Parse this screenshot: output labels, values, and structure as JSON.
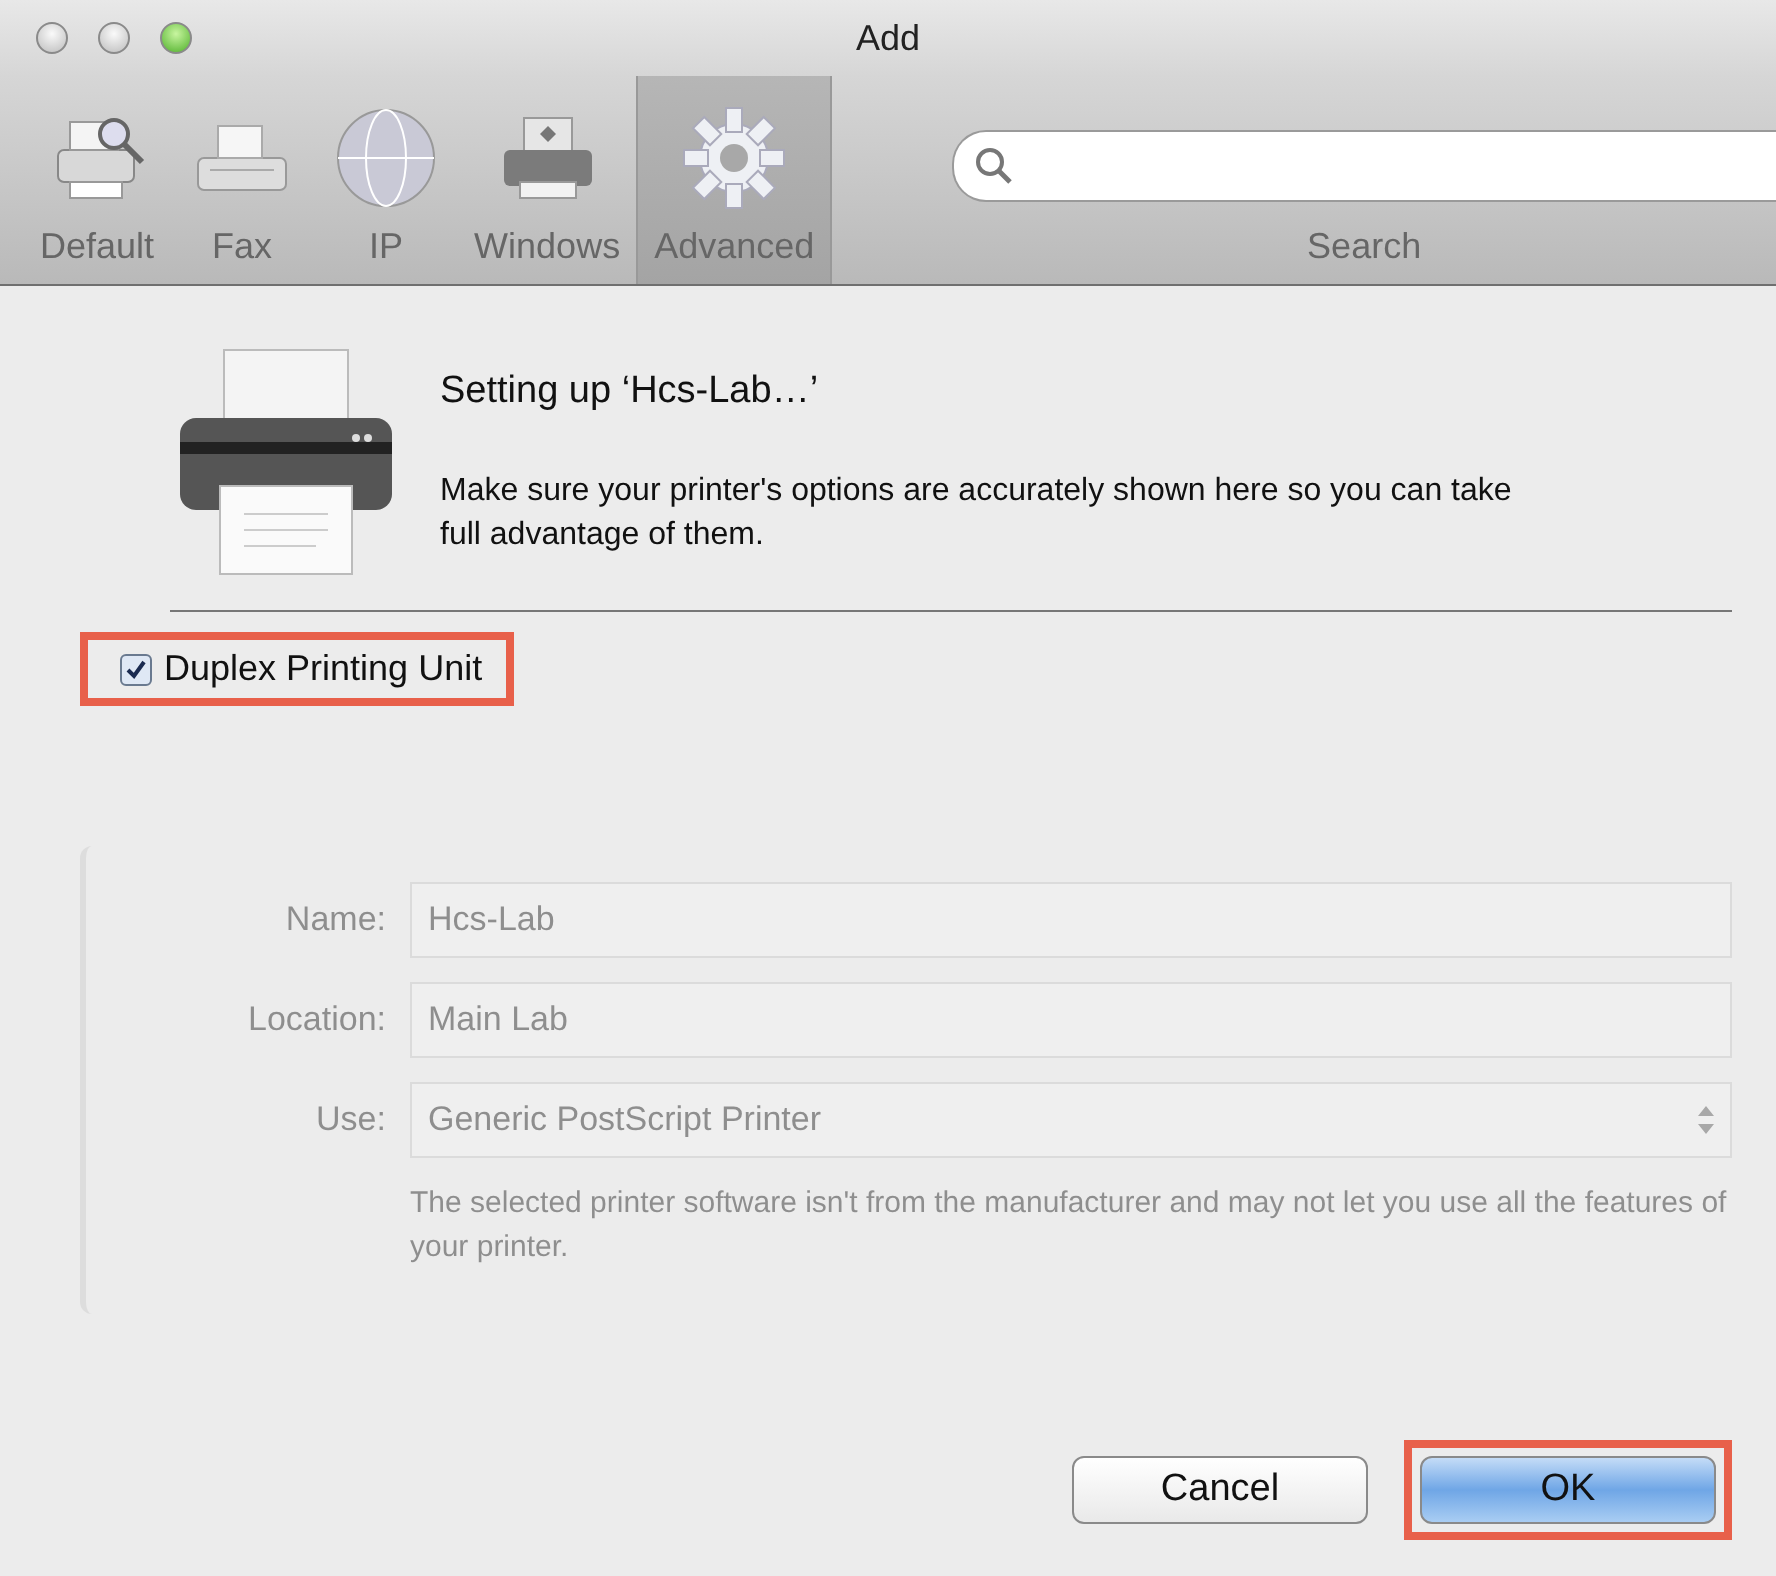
{
  "window": {
    "title": "Add"
  },
  "toolbar": {
    "items": [
      {
        "label": "Default",
        "kind": "default",
        "selected": false
      },
      {
        "label": "Fax",
        "kind": "fax",
        "selected": false
      },
      {
        "label": "IP",
        "kind": "ip",
        "selected": false
      },
      {
        "label": "Windows",
        "kind": "windows",
        "selected": false
      },
      {
        "label": "Advanced",
        "kind": "advanced",
        "selected": true
      }
    ],
    "search": {
      "label": "Search"
    }
  },
  "sheet": {
    "title": "Setting up ‘Hcs-Lab…’",
    "message": "Make sure your printer's options are accurately shown here so you can take full advantage of them.",
    "options": [
      {
        "label": "Duplex Printing Unit",
        "checked": true,
        "highlighted": true
      }
    ],
    "buttons": [
      {
        "label": "Cancel",
        "default": false,
        "highlighted": false
      },
      {
        "label": "OK",
        "default": true,
        "highlighted": true
      }
    ]
  },
  "background_form": {
    "disabled": true,
    "fields": [
      {
        "label": "Name:",
        "value": "Hcs-Lab",
        "kind": "text"
      },
      {
        "label": "Location:",
        "value": "Main Lab",
        "kind": "text"
      },
      {
        "label": "Use:",
        "value": "Generic PostScript Printer",
        "kind": "popup"
      }
    ],
    "note": "The selected printer software isn't from the manufacturer and may not let you use all the features of your printer."
  }
}
